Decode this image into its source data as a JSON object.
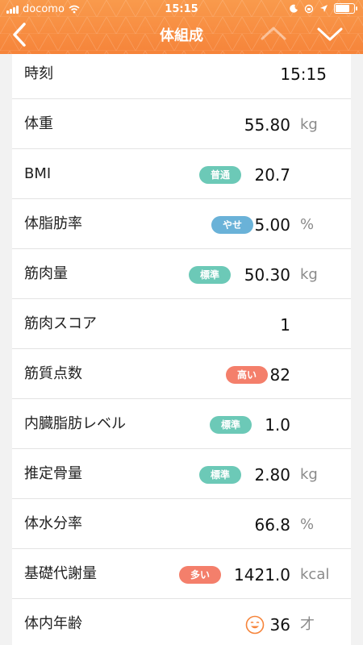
{
  "status_bar": {
    "carrier": "docomo",
    "time": "15:15"
  },
  "nav": {
    "title": "体組成"
  },
  "colors": {
    "header": "#f6843a",
    "badge_green": "#6cc9b7",
    "badge_blue": "#6ab2d8",
    "badge_red": "#f47f6b",
    "face": "#f6843a"
  },
  "rows": [
    {
      "label": "時刻",
      "value": "15:15"
    },
    {
      "label": "体重",
      "value": "55.80",
      "unit": "kg"
    },
    {
      "label": "BMI",
      "value": "20.7",
      "badge": "普通"
    },
    {
      "label": "体脂肪率",
      "value": "5.00",
      "unit": "%",
      "badge": "やせ"
    },
    {
      "label": "筋肉量",
      "value": "50.30",
      "unit": "kg",
      "badge": "標準"
    },
    {
      "label": "筋肉スコア",
      "value": "1"
    },
    {
      "label": "筋質点数",
      "value": "82",
      "badge": "高い"
    },
    {
      "label": "内臓脂肪レベル",
      "value": "1.0",
      "badge": "標準"
    },
    {
      "label": "推定骨量",
      "value": "2.80",
      "unit": "kg",
      "badge": "標準"
    },
    {
      "label": "体水分率",
      "value": "66.8",
      "unit": "%"
    },
    {
      "label": "基礎代謝量",
      "value": "1421.0",
      "unit": "kcal",
      "badge": "多い"
    },
    {
      "label": "体内年齢",
      "value": "36",
      "unit": "才",
      "icon": "smiley-face-icon"
    }
  ]
}
